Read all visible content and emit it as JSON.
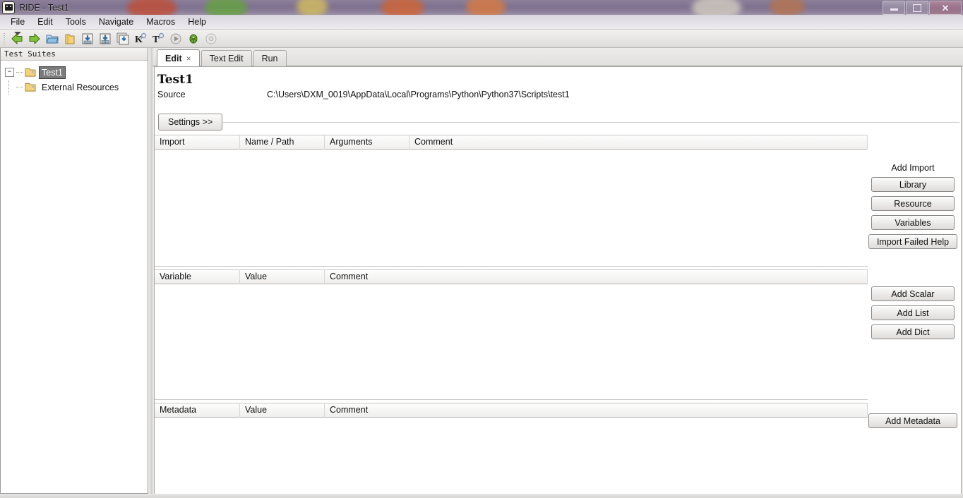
{
  "window": {
    "title": "RIDE - Test1",
    "app_icon": "robot-icon",
    "controls": {
      "minimize": "minimize-icon",
      "maximize": "maximize-icon",
      "close": "close-icon"
    },
    "titlebar_color": "#7e7290"
  },
  "menubar": {
    "items": [
      "File",
      "Edit",
      "Tools",
      "Navigate",
      "Macros",
      "Help"
    ]
  },
  "toolbar": {
    "overflow_label": "toolbar-overflow",
    "buttons": [
      {
        "name": "back-icon",
        "title": "Back"
      },
      {
        "name": "forward-icon",
        "title": "Forward"
      },
      {
        "name": "open-file-icon",
        "title": "Open"
      },
      {
        "name": "open-folder-icon",
        "title": "Open Directory"
      },
      {
        "name": "save-icon",
        "title": "Save"
      },
      {
        "name": "save-as-icon",
        "title": "Save As"
      },
      {
        "name": "save-all-icon",
        "title": "Save All"
      },
      {
        "name": "search-keyword-icon",
        "title": "K"
      },
      {
        "name": "search-tests-icon",
        "title": "T"
      },
      {
        "name": "run-icon",
        "title": "Run"
      },
      {
        "name": "debug-icon",
        "title": "Debug"
      },
      {
        "name": "stop-icon",
        "title": "Stop"
      }
    ]
  },
  "sidebar_tree": {
    "header": "Test Suites",
    "nodes": [
      {
        "label": "Test1",
        "selected": true,
        "expander": "−"
      },
      {
        "label": "External Resources",
        "selected": false,
        "expander": ""
      }
    ]
  },
  "tabs": [
    {
      "label": "Edit",
      "active": true,
      "close": "×"
    },
    {
      "label": "Text Edit",
      "active": false,
      "close": ""
    },
    {
      "label": "Run",
      "active": false,
      "close": ""
    }
  ],
  "editor": {
    "suite_name": "Test1",
    "source_label": "Source",
    "source_value": "C:\\Users\\DXM_0019\\AppData\\Local\\Programs\\Python\\Python37\\Scripts\\test1",
    "settings_button": "Settings >>"
  },
  "import_table": {
    "headers": [
      "Import",
      "Name / Path",
      "Arguments",
      "Comment"
    ],
    "rows": []
  },
  "variable_table": {
    "headers": [
      "Variable",
      "Value",
      "Comment"
    ],
    "rows": []
  },
  "metadata_table": {
    "headers": [
      "Metadata",
      "Value",
      "Comment"
    ],
    "rows": []
  },
  "import_panel": {
    "label": "Add Import",
    "buttons": [
      "Library",
      "Resource",
      "Variables",
      "Import Failed Help"
    ]
  },
  "variable_panel": {
    "buttons": [
      "Add Scalar",
      "Add List",
      "Add Dict"
    ]
  },
  "metadata_panel": {
    "buttons": [
      "Add Metadata"
    ]
  }
}
